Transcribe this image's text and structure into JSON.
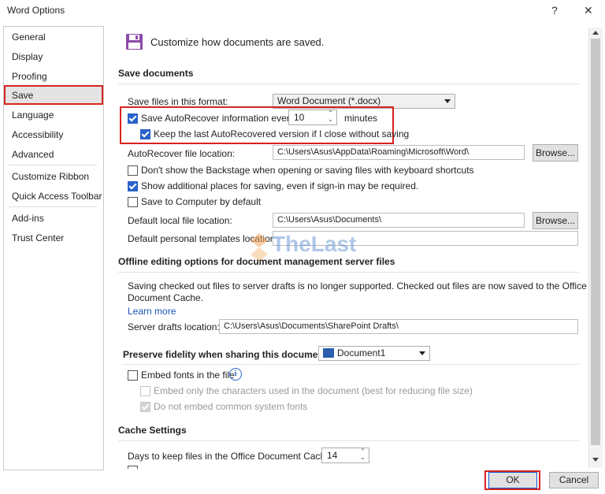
{
  "window": {
    "title": "Word Options",
    "help_glyph": "?",
    "close_glyph": "✕"
  },
  "nav": {
    "items": [
      "General",
      "Display",
      "Proofing",
      "Save",
      "Language",
      "Accessibility",
      "Advanced",
      "Customize Ribbon",
      "Quick Access Toolbar",
      "Add-ins",
      "Trust Center"
    ],
    "selected": "Save"
  },
  "header": {
    "text": "Customize how documents are saved."
  },
  "save_documents": {
    "heading": "Save documents",
    "format_label": "Save files in this format:",
    "format_value": "Word Document (*.docx)",
    "autorecover_label": "Save AutoRecover information every",
    "autorecover_minutes": "10",
    "minutes_label": "minutes",
    "keep_last_label": "Keep the last AutoRecovered version if I close without saving",
    "autorecover_location_label": "AutoRecover file location:",
    "autorecover_location_value": "C:\\Users\\Asus\\AppData\\Roaming\\Microsoft\\Word\\",
    "browse_label": "Browse...",
    "backstage_label": "Don't show the Backstage when opening or saving files with keyboard shortcuts",
    "additional_places_label": "Show additional places for saving, even if sign-in may be required.",
    "save_to_computer_label": "Save to Computer by default",
    "default_local_label": "Default local file location:",
    "default_local_value": "C:\\Users\\Asus\\Documents\\",
    "default_templates_label": "Default personal templates location:",
    "default_templates_value": ""
  },
  "offline": {
    "heading": "Offline editing options for document management server files",
    "desc1": "Saving checked out files to server drafts is no longer supported. Checked out files are now saved to the Office",
    "desc2": "Document Cache.",
    "learn_more": "Learn more",
    "server_drafts_label": "Server drafts location:",
    "server_drafts_value": "C:\\Users\\Asus\\Documents\\SharePoint Drafts\\"
  },
  "fidelity": {
    "heading": "Preserve fidelity when sharing this document:",
    "document": "Document1",
    "embed_fonts_label": "Embed fonts in the file",
    "embed_only_label": "Embed only the characters used in the document (best for reducing file size)",
    "no_common_label": "Do not embed common system fonts"
  },
  "cache": {
    "heading": "Cache Settings",
    "days_label": "Days to keep files in the Office Document Cache:",
    "days_value": "14"
  },
  "footer": {
    "ok_label": "OK",
    "cancel_label": "Cancel"
  },
  "watermark": {
    "text": "TheLast"
  },
  "colors": {
    "highlight": "#d9231d",
    "checkbox": "#2a62c9",
    "link": "#1a56b6"
  }
}
